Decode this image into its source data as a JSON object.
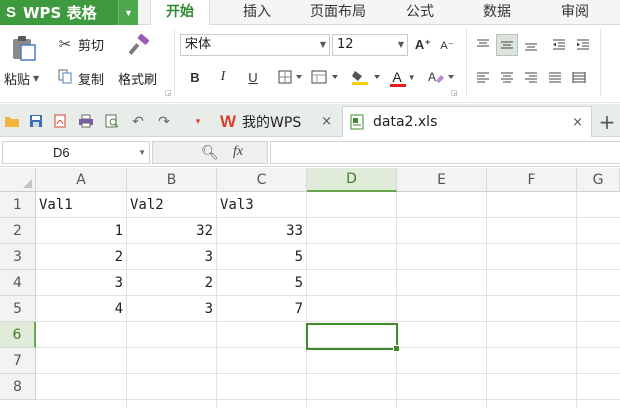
{
  "app": {
    "logo": "S",
    "name": "WPS 表格"
  },
  "menu": {
    "tabs": [
      "开始",
      "插入",
      "页面布局",
      "公式",
      "数据",
      "审阅"
    ],
    "active": "开始"
  },
  "ribbon": {
    "cut_label": "剪切",
    "paste_label": "粘贴",
    "copy_label": "复制",
    "format_painter_label": "格式刷",
    "font_name": "宋体",
    "font_size": "12",
    "bold": "B",
    "italic": "I",
    "underline": "U",
    "font_color_letter": "A",
    "font_color": "#e02020",
    "fill_color": "#f5d10f",
    "increase_font_glyph": "A⁺",
    "decrease_font_glyph": "A⁻"
  },
  "quick_access": {
    "icons": [
      "open-folder-icon",
      "save-icon",
      "pdf-export-icon",
      "print-icon",
      "print-preview-icon",
      "undo-icon",
      "redo-icon",
      "customize-icon"
    ]
  },
  "doc_tabs": [
    {
      "label": "我的WPS",
      "icon": "wps-logo-icon",
      "close": "×"
    },
    {
      "label": "data2.xls",
      "icon": "spreadsheet-file-icon",
      "close": "×",
      "active": true
    }
  ],
  "new_tab_glyph": "+",
  "formula_bar": {
    "name_box": "D6",
    "fx": "fx",
    "formula": ""
  },
  "sheet": {
    "columns": [
      "A",
      "B",
      "C",
      "D",
      "E",
      "F",
      "G"
    ],
    "rows": [
      "1",
      "2",
      "3",
      "4",
      "5",
      "6",
      "7",
      "8"
    ],
    "selected_column": "D",
    "selected_row": "6",
    "cells": {
      "A1": "Val1",
      "B1": "Val2",
      "C1": "Val3",
      "A2": "1",
      "B2": "32",
      "C2": "33",
      "A3": "2",
      "B3": "3",
      "C3": "5",
      "A4": "3",
      "B4": "2",
      "C4": "5",
      "A5": "4",
      "B5": "3",
      "C5": "7"
    }
  },
  "colors": {
    "accent_green": "#3f9a3f",
    "selection_green": "#3d8b2a"
  }
}
